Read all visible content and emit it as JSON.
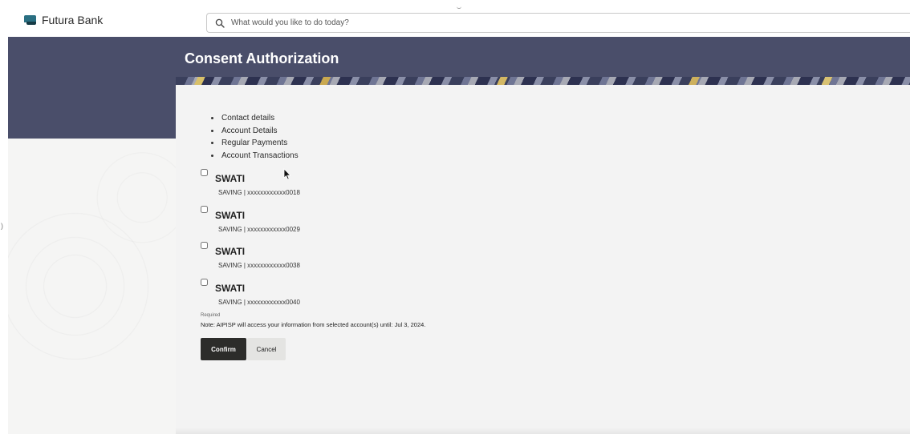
{
  "app": {
    "brand_name": "Futura Bank",
    "brand_icon": "bank-logo-icon",
    "search_placeholder": "What would you like to do today?"
  },
  "page": {
    "title": "Consent Authorization"
  },
  "consent_items": [
    "Contact details",
    "Account Details",
    "Regular Payments",
    "Account Transactions"
  ],
  "accounts": [
    {
      "name": "SWATI",
      "detail": "SAVING | xxxxxxxxxxxx0018",
      "checked": false
    },
    {
      "name": "SWATI",
      "detail": "SAVING | xxxxxxxxxxxx0029",
      "checked": false
    },
    {
      "name": "SWATI",
      "detail": "SAVING | xxxxxxxxxxxx0038",
      "checked": false
    },
    {
      "name": "SWATI",
      "detail": "SAVING | xxxxxxxxxxxx0040",
      "checked": false
    }
  ],
  "form": {
    "required_label": "Required",
    "note": "Note: AIPISP will access your information from selected account(s) until: Jul 3, 2024.",
    "confirm_label": "Confirm",
    "cancel_label": "Cancel"
  },
  "colors": {
    "header_band": "#4a4e6a",
    "card_background": "#f3f3f3",
    "confirm_button": "#2c2c2a",
    "brand_teal": "#2a6f82"
  }
}
